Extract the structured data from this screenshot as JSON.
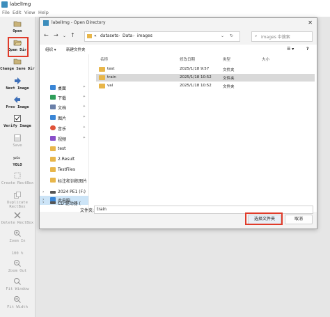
{
  "app": {
    "title": "labelImg"
  },
  "menu": [
    "File",
    "Edit",
    "View",
    "Help"
  ],
  "toolbar": [
    {
      "label": "Open",
      "icon": "folder-icon",
      "enabled": true
    },
    {
      "label": "Open Dir",
      "icon": "folder-open-icon",
      "enabled": true,
      "highlighted": true
    },
    {
      "label": "Change Save Dir",
      "icon": "folder-icon",
      "enabled": true
    },
    {
      "label": "Next Image",
      "icon": "arrow-right-icon",
      "enabled": true
    },
    {
      "label": "Prev Image",
      "icon": "arrow-left-icon",
      "enabled": true
    },
    {
      "label": "Verify Image",
      "icon": "checkbox-icon",
      "enabled": true
    },
    {
      "label": "Save",
      "icon": "save-icon",
      "enabled": false
    },
    {
      "label": "YOLO",
      "icon": "format-icon",
      "enabled": true
    },
    {
      "label": "Create RectBox",
      "icon": "draw-box-icon",
      "enabled": false
    },
    {
      "label": "Duplicate RectBox",
      "icon": "copy-icon",
      "enabled": false
    },
    {
      "label": "Delete RectBox",
      "icon": "delete-icon",
      "enabled": false
    },
    {
      "label": "Zoom In",
      "icon": "zoom-in-icon",
      "enabled": false
    },
    {
      "label": "100 %",
      "icon": "zoom-value",
      "enabled": false
    },
    {
      "label": "Zoom Out",
      "icon": "zoom-out-icon",
      "enabled": false
    },
    {
      "label": "Fit Window",
      "icon": "fit-window-icon",
      "enabled": false
    },
    {
      "label": "Fit Width",
      "icon": "fit-width-icon",
      "enabled": false
    }
  ],
  "dialog": {
    "title": "labelImg - Open Directory",
    "breadcrumb": [
      "«",
      "datasets",
      "Data",
      "images"
    ],
    "search_placeholder": "images 中搜索",
    "organize": "组织 ▾",
    "new_folder": "新建文件夹",
    "sidebar": [
      {
        "label": "桌面",
        "icon": "desktop-icon",
        "color": "#3a86d6",
        "pinned": true
      },
      {
        "label": "下载",
        "icon": "download-icon",
        "color": "#2f9e5a",
        "pinned": true
      },
      {
        "label": "文档",
        "icon": "documents-icon",
        "color": "#6a7fa8",
        "pinned": true
      },
      {
        "label": "图片",
        "icon": "pictures-icon",
        "color": "#3a86d6",
        "pinned": true
      },
      {
        "label": "音乐",
        "icon": "music-icon",
        "color": "#e0533a",
        "pinned": true
      },
      {
        "label": "视频",
        "icon": "video-icon",
        "color": "#8a4fc9",
        "pinned": true
      },
      {
        "label": "test",
        "icon": "folder-icon",
        "color": "#e8b64a",
        "pinned": false
      },
      {
        "label": "2.Result",
        "icon": "folder-icon",
        "color": "#e8b64a",
        "pinned": false
      },
      {
        "label": "TestFiles",
        "icon": "folder-icon",
        "color": "#e8b64a",
        "pinned": false
      },
      {
        "label": "标注和训练图片",
        "icon": "folder-icon",
        "color": "#e8b64a",
        "pinned": false
      },
      {
        "label": "此电脑",
        "icon": "pc-icon",
        "color": "#3a86d6",
        "pinned": false
      },
      {
        "label": "2024 PE1 (F:)",
        "icon": "drive-icon",
        "color": "#555555",
        "pinned": false
      },
      {
        "label": "CD 驱动器 (",
        "icon": "cd-drive-icon",
        "color": "#555555",
        "pinned": false
      }
    ],
    "columns": [
      "名称",
      "修改日期",
      "类型",
      "大小"
    ],
    "files": [
      {
        "name": "test",
        "date": "2025/1/18 9:57",
        "type": "文件夹",
        "size": ""
      },
      {
        "name": "train",
        "date": "2025/1/18 10:52",
        "type": "文件夹",
        "size": ""
      },
      {
        "name": "val",
        "date": "2025/1/18 10:52",
        "type": "文件夹",
        "size": ""
      }
    ],
    "folder_label": "文件夹:",
    "folder_value": "train",
    "select_button": "选择文件夹",
    "cancel_button": "取消"
  },
  "colors": {
    "highlight": "#e03b2a",
    "selection": "#cce4f7"
  }
}
